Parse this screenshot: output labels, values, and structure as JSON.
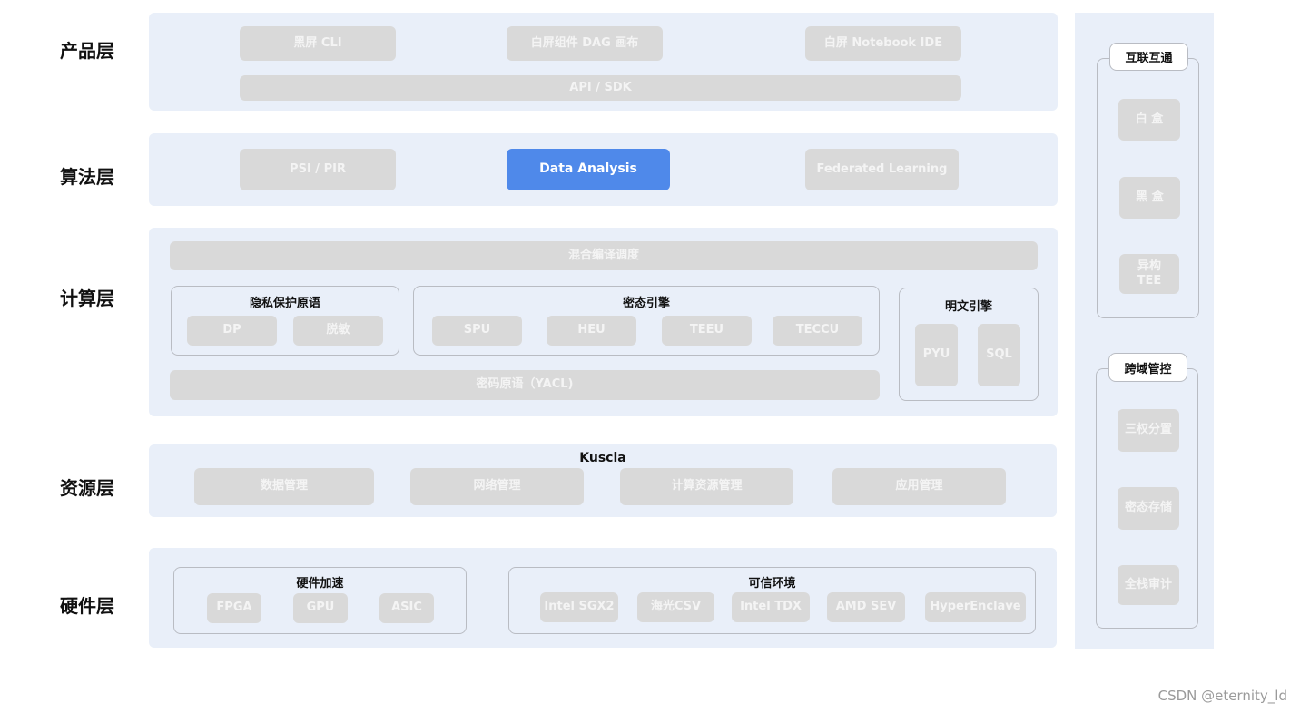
{
  "layers": {
    "product": "产品层",
    "algorithm": "算法层",
    "compute": "计算层",
    "resource": "资源层",
    "hardware": "硬件层"
  },
  "product": {
    "items": [
      "黑屏 CLI",
      "白屏组件 DAG 画布",
      "白屏 Notebook IDE"
    ],
    "api": "API / SDK"
  },
  "algorithm": {
    "items": [
      "PSI / PIR",
      "Data Analysis",
      "Federated Learning"
    ],
    "highlighted": "Data Analysis",
    "highlight_color": "#4f89ea"
  },
  "compute": {
    "scheduler": "混合编译调度",
    "privacy_primitives": {
      "title": "隐私保护原语",
      "items": [
        "DP",
        "脱敏"
      ]
    },
    "cipher_engine": {
      "title": "密态引擎",
      "items": [
        "SPU",
        "HEU",
        "TEEU",
        "TECCU"
      ]
    },
    "plain_engine": {
      "title": "明文引擎",
      "items": [
        "PYU",
        "SQL"
      ]
    },
    "crypto_primitives": "密码原语（YACL)"
  },
  "resource": {
    "title": "Kuscia",
    "items": [
      "数据管理",
      "网络管理",
      "计算资源管理",
      "应用管理"
    ]
  },
  "hardware": {
    "acceleration": {
      "title": "硬件加速",
      "items": [
        "FPGA",
        "GPU",
        "ASIC"
      ]
    },
    "trusted_env": {
      "title": "可信环境",
      "items": [
        "Intel SGX2",
        "海光CSV",
        "Intel TDX",
        "AMD SEV",
        "HyperEnclave"
      ]
    }
  },
  "side": {
    "interconnect": {
      "title": "互联互通",
      "items": [
        "白 盒",
        "黑 盒",
        "异构\nTEE"
      ]
    },
    "cross_domain": {
      "title": "跨域管控",
      "items": [
        "三权分置",
        "密态存储",
        "全栈审计"
      ]
    }
  },
  "watermark": "CSDN @eternity_ld",
  "colors": {
    "panel": "#e9eff9",
    "pill": "#d9d9d9"
  }
}
